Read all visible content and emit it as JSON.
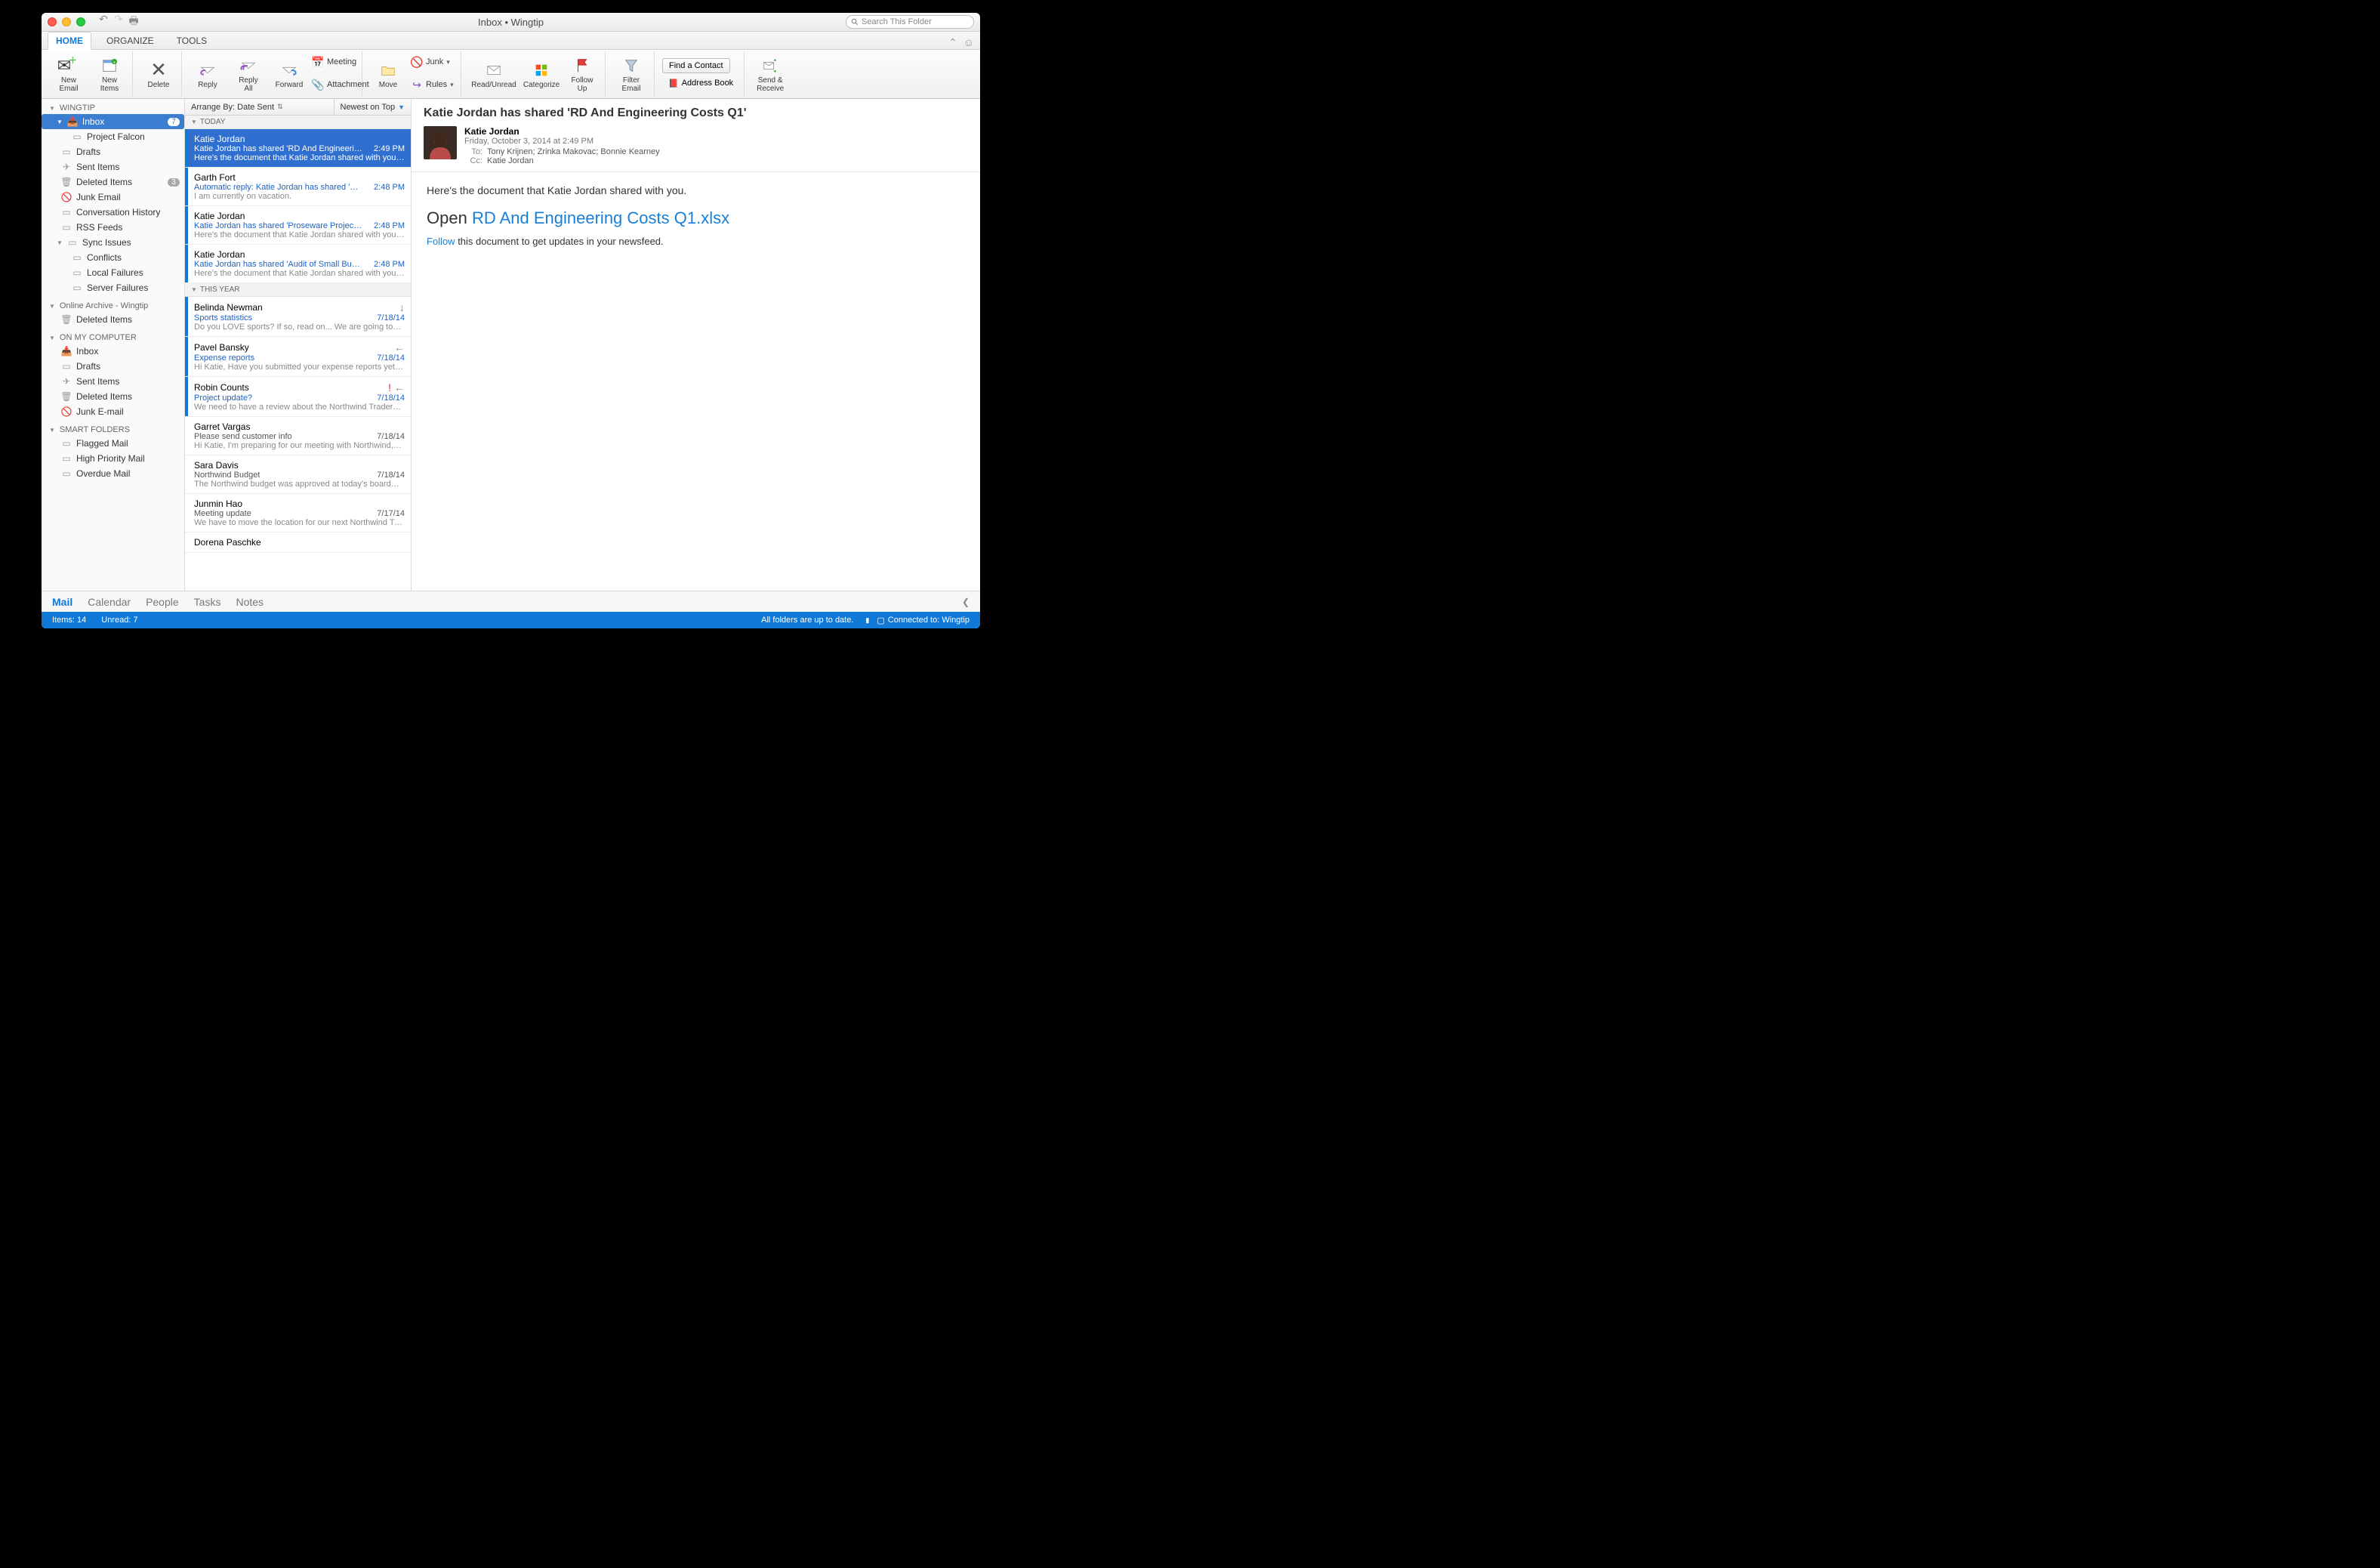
{
  "window": {
    "title": "Inbox • Wingtip"
  },
  "search": {
    "placeholder": "Search This Folder"
  },
  "tabs": {
    "home": "HOME",
    "organize": "ORGANIZE",
    "tools": "TOOLS"
  },
  "ribbon": {
    "new_email": "New\nEmail",
    "new_items": "New\nItems",
    "delete": "Delete",
    "reply": "Reply",
    "reply_all": "Reply\nAll",
    "forward": "Forward",
    "meeting": "Meeting",
    "attachment": "Attachment",
    "move": "Move",
    "junk": "Junk",
    "rules": "Rules",
    "read_unread": "Read/Unread",
    "categorize": "Categorize",
    "follow_up": "Follow\nUp",
    "filter_email": "Filter\nEmail",
    "find_contact": "Find a Contact",
    "address_book": "Address Book",
    "send_receive": "Send &\nReceive"
  },
  "sidebar": {
    "wingtip": "WINGTIP",
    "inbox": "Inbox",
    "inbox_count": "7",
    "project_falcon": "Project Falcon",
    "drafts": "Drafts",
    "sent_items": "Sent Items",
    "deleted_items": "Deleted Items",
    "deleted_count": "3",
    "junk_email": "Junk Email",
    "conversation_history": "Conversation History",
    "rss_feeds": "RSS Feeds",
    "sync_issues": "Sync Issues",
    "conflicts": "Conflicts",
    "local_failures": "Local Failures",
    "server_failures": "Server Failures",
    "online_archive": "Online Archive - Wingtip",
    "oa_deleted": "Deleted Items",
    "on_my_computer": "ON MY COMPUTER",
    "omc_inbox": "Inbox",
    "omc_drafts": "Drafts",
    "omc_sent": "Sent Items",
    "omc_deleted": "Deleted Items",
    "omc_junk": "Junk E-mail",
    "smart_folders": "SMART FOLDERS",
    "flagged": "Flagged Mail",
    "high_priority": "High Priority Mail",
    "overdue": "Overdue Mail"
  },
  "list": {
    "arrange_by": "Arrange By: Date Sent",
    "sort": "Newest on Top",
    "groups": {
      "today": "TODAY",
      "this_year": "THIS YEAR"
    },
    "msgs": [
      {
        "sender": "Katie Jordan",
        "subject": "Katie Jordan has shared 'RD And Engineeri…",
        "preview": "Here's the document that Katie Jordan shared with you…",
        "time": "2:49 PM"
      },
      {
        "sender": "Garth Fort",
        "subject": "Automatic reply: Katie Jordan has shared '…",
        "preview": "I am currently on vacation.",
        "time": "2:48 PM"
      },
      {
        "sender": "Katie Jordan",
        "subject": "Katie Jordan has shared 'Proseware Projec…",
        "preview": "Here's the document that Katie Jordan shared with you…",
        "time": "2:48 PM"
      },
      {
        "sender": "Katie Jordan",
        "subject": "Katie Jordan has shared 'Audit of Small Bu…",
        "preview": "Here's the document that Katie Jordan shared with you…",
        "time": "2:48 PM"
      },
      {
        "sender": "Belinda Newman",
        "subject": "Sports statistics",
        "preview": "Do you LOVE sports? If so, read on... We are going to…",
        "time": "7/18/14"
      },
      {
        "sender": "Pavel Bansky",
        "subject": "Expense reports",
        "preview": "Hi Katie, Have you submitted your expense reports yet…",
        "time": "7/18/14"
      },
      {
        "sender": "Robin Counts",
        "subject": "Project update?",
        "preview": "We need to have a review about the Northwind Traders…",
        "time": "7/18/14"
      },
      {
        "sender": "Garret Vargas",
        "subject": "Please send customer info",
        "preview": "Hi Katie, I'm preparing for our meeting with Northwind,…",
        "time": "7/18/14"
      },
      {
        "sender": "Sara Davis",
        "subject": "Northwind Budget",
        "preview": "The Northwind budget was approved at today's board…",
        "time": "7/18/14"
      },
      {
        "sender": "Junmin Hao",
        "subject": "Meeting update",
        "preview": "We have to move the location for our next Northwind Tr…",
        "time": "7/17/14"
      },
      {
        "sender": "Dorena Paschke",
        "subject": "",
        "preview": "",
        "time": ""
      }
    ]
  },
  "reader": {
    "subject": "Katie Jordan has shared 'RD And Engineering Costs Q1'",
    "from": "Katie Jordan",
    "date": "Friday, October 3, 2014 at 2:49 PM",
    "to_label": "To:",
    "to": "Tony Krijnen;   Zrinka Makovac;   Bonnie Kearney",
    "cc_label": "Cc:",
    "cc": "Katie Jordan",
    "body_intro": "Here's the document that Katie Jordan shared with you.",
    "open_prefix": "Open ",
    "open_link": "RD And Engineering Costs Q1.xlsx",
    "follow_link": "Follow",
    "follow_rest": " this document to get updates in your newsfeed."
  },
  "nav": {
    "mail": "Mail",
    "calendar": "Calendar",
    "people": "People",
    "tasks": "Tasks",
    "notes": "Notes"
  },
  "status": {
    "items": "Items: 14",
    "unread": "Unread: 7",
    "sync": "All folders are up to date.",
    "connected": "Connected to: Wingtip"
  }
}
